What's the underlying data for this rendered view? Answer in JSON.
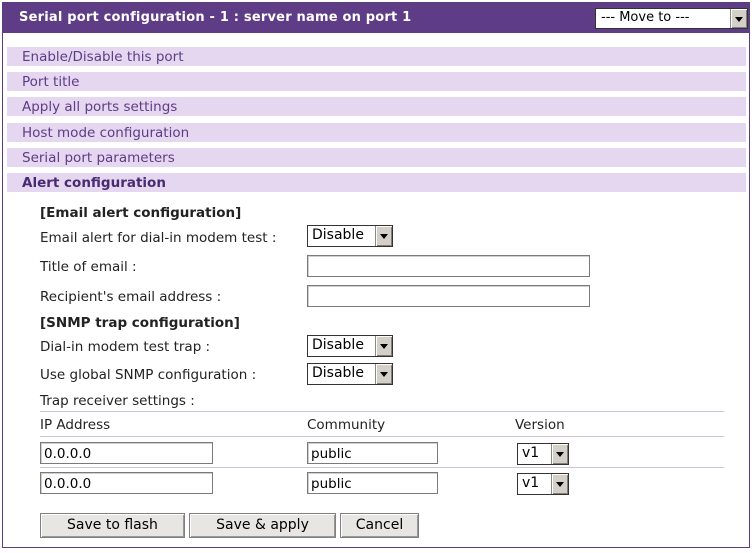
{
  "header": {
    "title": "Serial port configuration - 1 : server name on port 1",
    "move_to": "--- Move to ---"
  },
  "menu": [
    "Enable/Disable this port",
    "Port title",
    "Apply all ports settings",
    "Host mode configuration",
    "Serial port parameters",
    "Alert configuration"
  ],
  "email": {
    "section": "[Email alert configuration]",
    "dialin_label": "Email alert for dial-in modem test :",
    "dialin_value": "Disable",
    "title_label": "Title of email :",
    "title_value": "",
    "recipient_label": "Recipient's email address :",
    "recipient_value": ""
  },
  "snmp": {
    "section": "[SNMP trap configuration]",
    "dialin_label": "Dial-in modem test trap :",
    "dialin_value": "Disable",
    "global_label": "Use global SNMP configuration :",
    "global_value": "Disable",
    "receiver_label": "Trap receiver settings :"
  },
  "table": {
    "headers": [
      "IP Address",
      "Community",
      "Version"
    ],
    "rows": [
      {
        "ip": "0.0.0.0",
        "community": "public",
        "version": "v1"
      },
      {
        "ip": "0.0.0.0",
        "community": "public",
        "version": "v1"
      }
    ]
  },
  "buttons": {
    "save_flash": "Save to flash",
    "save_apply": "Save & apply",
    "cancel": "Cancel"
  },
  "colors": {
    "header_bg": "#5e3c86",
    "menu_bg": "#e4d7ef",
    "menu_text": "#5e3c86"
  }
}
